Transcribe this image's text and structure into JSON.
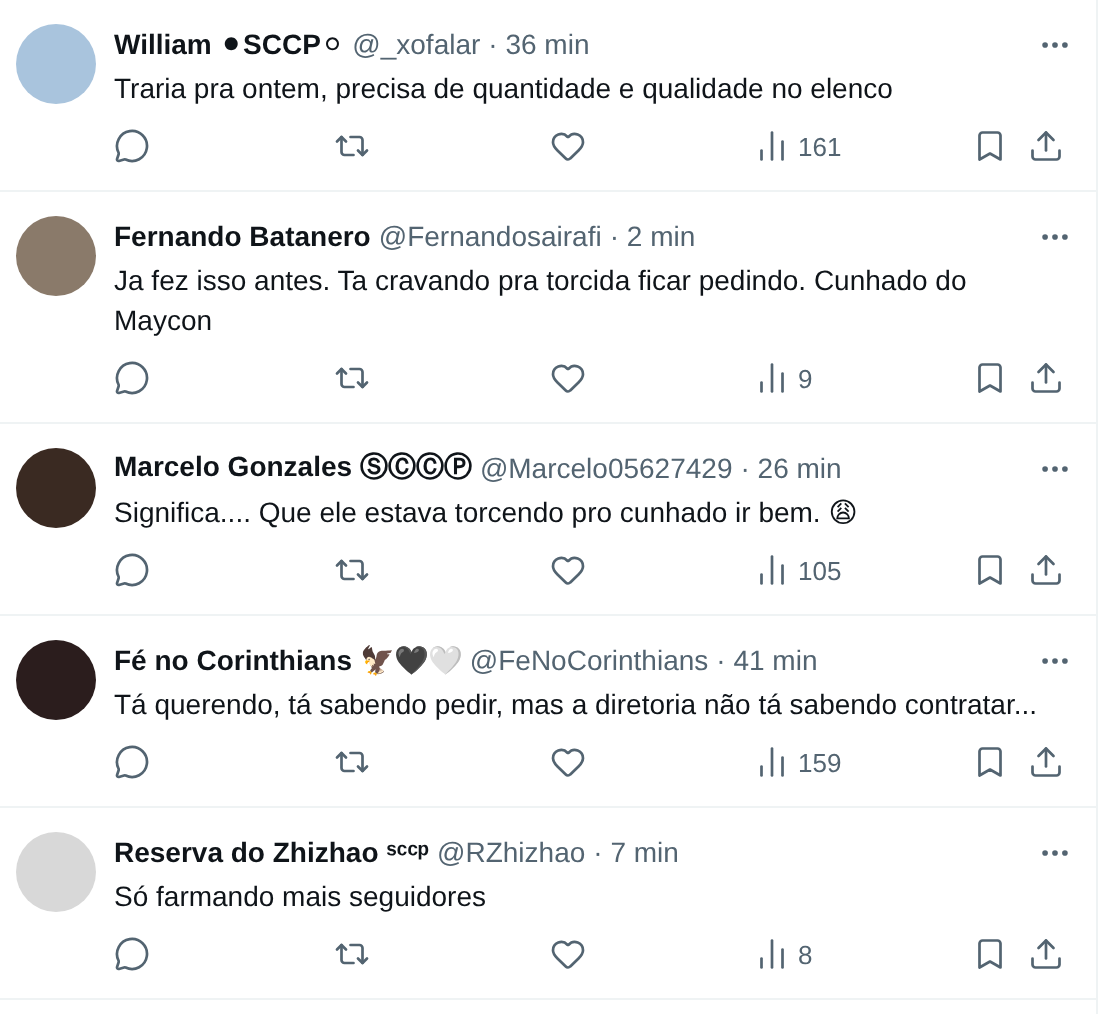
{
  "replies": [
    {
      "name": "William ⚫SCCP⚪",
      "handle": "@_xofalar",
      "time": "· 36 min",
      "text": "Traria pra ontem, precisa de quantidade e qualidade no elenco",
      "views": "161"
    },
    {
      "name": "Fernando Batanero",
      "handle": "@Fernandosairafi",
      "time": "· 2 min",
      "text": "Ja fez isso antes. Ta cravando pra torcida ficar pedindo. Cunhado do Maycon",
      "views": "9"
    },
    {
      "name": "Marcelo Gonzales ⓈⒸⒸⓅ",
      "handle": "@Marcelo05627429",
      "time": "· 26 min",
      "text": "Significa.... Que ele estava torcendo pro cunhado ir bem. 😩",
      "views": "105"
    },
    {
      "name": "Fé no Corinthians 🦅🖤🤍",
      "handle": "@FeNoCorinthians",
      "time": "· 41 min",
      "text": "Tá querendo, tá sabendo pedir, mas a diretoria não tá sabendo contratar...",
      "views": "159"
    },
    {
      "name": "Reserva do Zhizhao ˢᶜᶜᵖ",
      "handle": "@RZhizhao",
      "time": "· 7 min",
      "text": "Só farmando mais seguidores",
      "views": "8"
    }
  ]
}
